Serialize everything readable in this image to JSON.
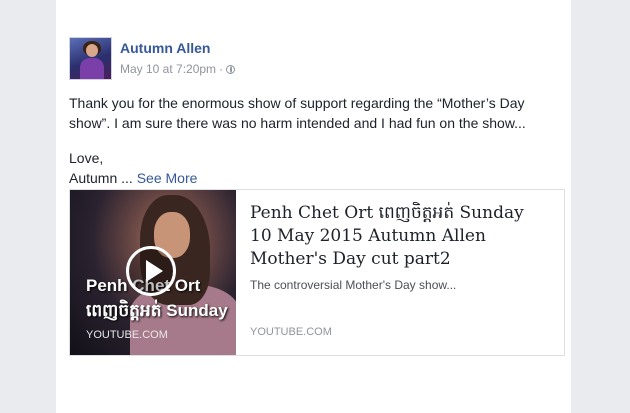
{
  "post": {
    "author": "Autumn Allen",
    "timestamp": "May 10 at 7:20pm",
    "separator": "·",
    "privacy_icon": "globe-icon",
    "text_line1": "Thank you for the enormous show of support regarding the “Mother’s Day show”. I am sure there was no harm intended and I had fun on the show...",
    "text_line2": "Love,",
    "text_line3": "Autumn ...",
    "see_more": "See More"
  },
  "link": {
    "thumb_title_1": "Penh Chet Ort",
    "thumb_title_2": "ពេញចិត្តអត់ Sunday",
    "thumb_source": "YOUTUBE.COM",
    "play_icon": "play-icon",
    "title": "Penh Chet Ort ពេញចិត្តអត់ Sunday 10 May 2015 Autumn Allen Mother's Day cut part2",
    "description": "The controversial Mother's Day show...",
    "domain": "YOUTUBE.COM"
  },
  "colors": {
    "link_blue": "#365899",
    "meta_gray": "#90949c",
    "page_bg": "#e9ebee"
  }
}
